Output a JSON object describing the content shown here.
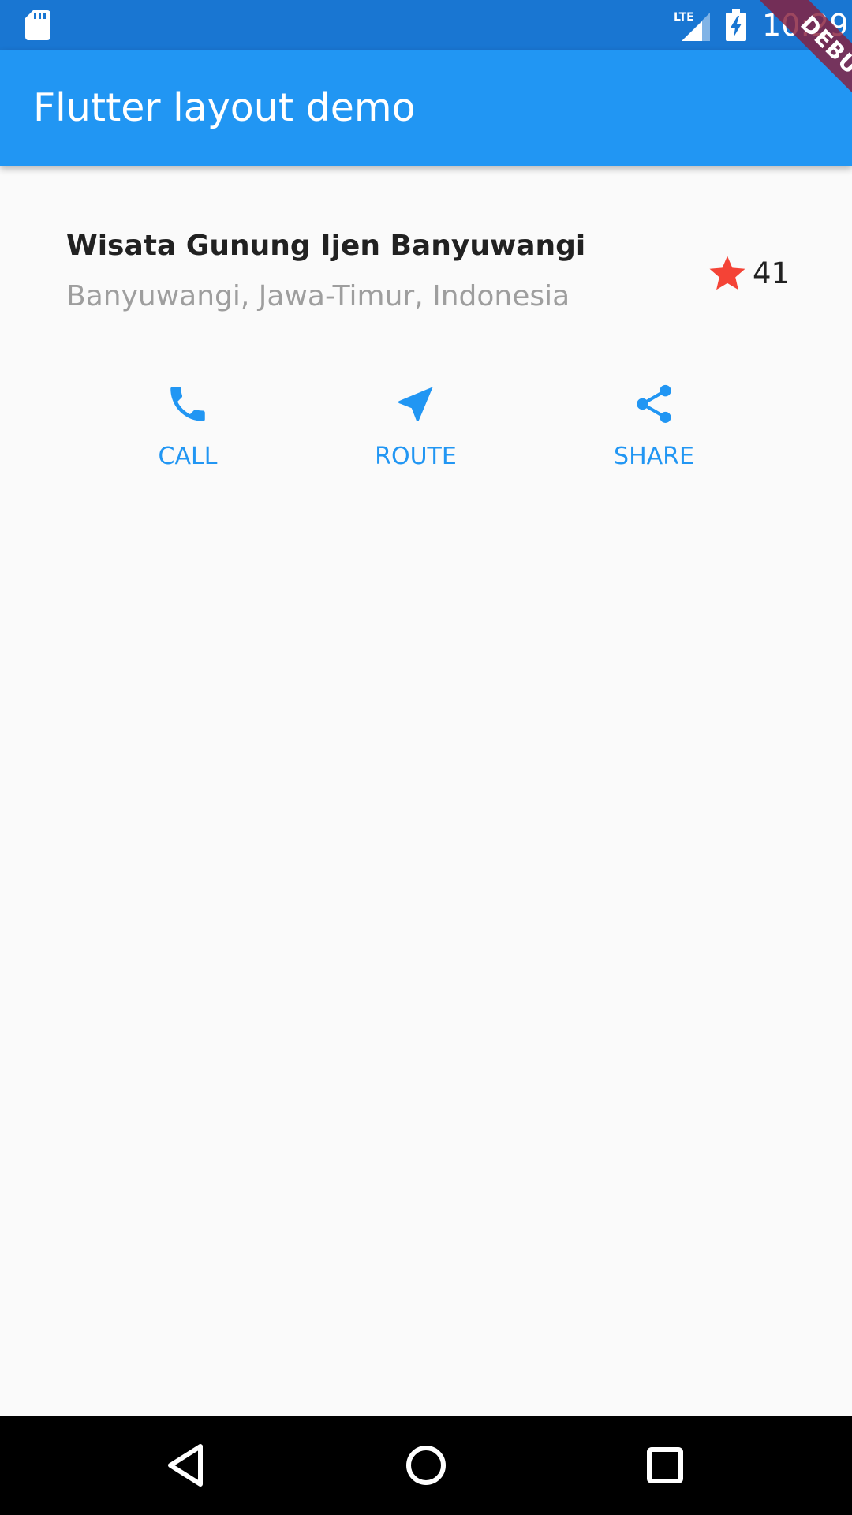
{
  "status_bar": {
    "time": "10:29",
    "network": "LTE",
    "icons": [
      "sd-card-icon",
      "lte-signal-icon",
      "battery-charging-icon"
    ]
  },
  "debug_banner": {
    "label": "DEBUG"
  },
  "app_bar": {
    "title": "Flutter layout demo"
  },
  "title_section": {
    "title": "Wisata Gunung Ijen Banyuwangi",
    "location": "Banyuwangi, Jawa-Timur, Indonesia",
    "rating_icon": "star-icon",
    "rating_count": "41"
  },
  "buttons": [
    {
      "label": "CALL",
      "icon": "phone-icon"
    },
    {
      "label": "ROUTE",
      "icon": "navigation-icon"
    },
    {
      "label": "SHARE",
      "icon": "share-icon"
    }
  ],
  "nav_bar": {
    "icons": [
      "back-icon",
      "home-icon",
      "recents-icon"
    ]
  },
  "colors": {
    "status_bar": "#1976d2",
    "app_bar": "#2196f3",
    "accent": "#2196f3",
    "star": "#f44336",
    "background": "#fafafa",
    "subtitle": "#9e9e9e"
  }
}
